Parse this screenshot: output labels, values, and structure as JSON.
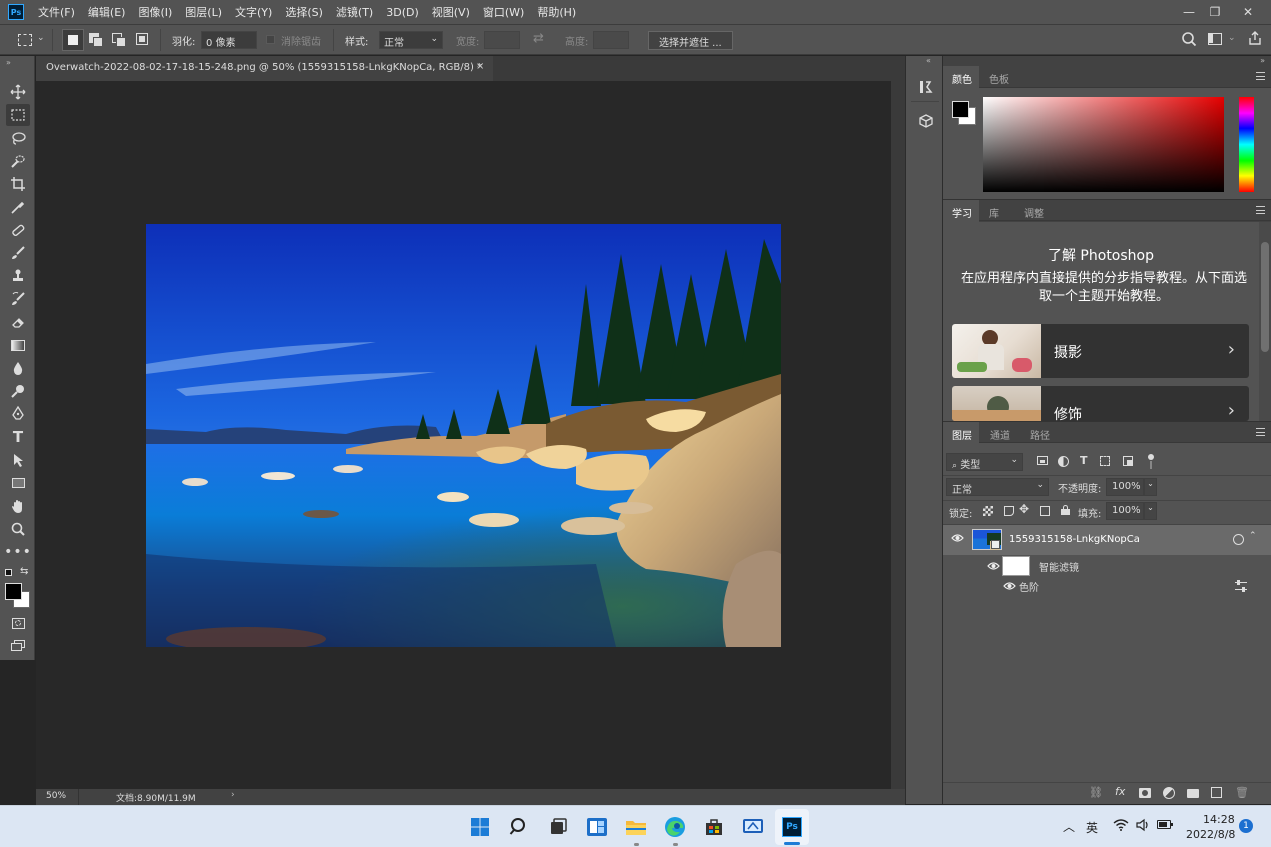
{
  "app": {
    "logo_text": "Ps"
  },
  "menubar": {
    "items": [
      "文件(F)",
      "编辑(E)",
      "图像(I)",
      "图层(L)",
      "文字(Y)",
      "选择(S)",
      "滤镜(T)",
      "3D(D)",
      "视图(V)",
      "窗口(W)",
      "帮助(H)"
    ]
  },
  "window_controls": {
    "minimize": "—",
    "restore": "❐",
    "close": "✕"
  },
  "options": {
    "feather_label": "羽化:",
    "feather_value": "0 像素",
    "antialias_label": "消除锯齿",
    "style_label": "样式:",
    "style_value": "正常",
    "width_label": "宽度:",
    "height_label": "高度:",
    "select_mask_button": "选择并遮住 ..."
  },
  "document": {
    "tab_title": "Overwatch-2022-08-02-17-18-15-248.png @ 50% (1559315158-LnkgKNopCa, RGB/8) *",
    "tab_close": "×",
    "zoom": "50%",
    "doc_info": "文档:8.90M/11.9M",
    "info_arrow": "›"
  },
  "color_panel": {
    "tabs": [
      "颜色",
      "色板"
    ]
  },
  "learn_panel": {
    "tabs": [
      "学习",
      "库",
      "调整"
    ],
    "title": "了解 Photoshop",
    "description": "在应用程序内直接提供的分步指导教程。从下面选取一个主题开始教程。",
    "cards": [
      {
        "label": "摄影"
      },
      {
        "label": "修饰"
      }
    ]
  },
  "layers_panel": {
    "tabs": [
      "图层",
      "通道",
      "路径"
    ],
    "filter_label": "类型",
    "blend_mode": "正常",
    "opacity_label": "不透明度:",
    "opacity_value": "100%",
    "lock_label": "锁定:",
    "fill_label": "填充:",
    "fill_value": "100%",
    "layers": [
      {
        "name": "1559315158-LnkgKNopCa"
      }
    ],
    "smart_filter_label": "智能滤镜",
    "filters": [
      {
        "name": "色阶"
      }
    ]
  },
  "taskbar": {
    "ime": "英",
    "time": "14:28",
    "date": "2022/8/8",
    "notifications": "1"
  },
  "colors": {
    "ps_blue": "#31a8ff",
    "panel_bg": "#535353",
    "canvas_bg": "#282828",
    "taskbar_bg": "#dce6f3"
  }
}
